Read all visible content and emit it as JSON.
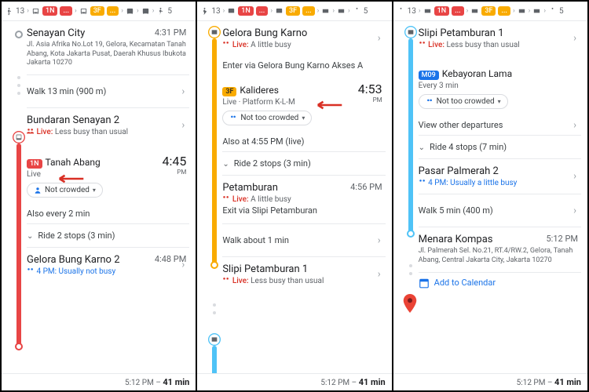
{
  "header": {
    "walk1": "13",
    "route1": "1N",
    "ellipsis": "...",
    "route2": "3F",
    "walk2": "5"
  },
  "p1": {
    "start": {
      "name": "Senayan City",
      "addr": "Jl. Asia Afrika No.Lot 19, Gelora, Kecamatan Tanah Abang, Kota Jakarta Pusat, Daerah Khusus Ibukota Jakarta 10270",
      "time": "4:31 PM"
    },
    "walk1": "Walk 13 min (900 m)",
    "stop1": {
      "name": "Bundaran Senayan 2",
      "live": "Less busy than usual"
    },
    "route": {
      "badge": "1N",
      "dest": "Tanah Abang",
      "live": "Live",
      "time": "4:45",
      "pm": "PM",
      "crowd": "Not crowded"
    },
    "also": "Also every 2 min",
    "ride": "Ride 2 stops (3 min)",
    "stop2": {
      "name": "Gelora Bung Karno 2",
      "hist": "4 PM: Usually not busy",
      "time": "4:48 PM"
    }
  },
  "p2": {
    "stop1": {
      "name": "Gelora Bung Karno",
      "live": "A little busy"
    },
    "enter": "Enter via Gelora Bung Karno Akses A",
    "route": {
      "badge": "3F",
      "dest": "Kalideres",
      "live": "Live · Platform K-L-M",
      "time": "4:53",
      "pm": "PM",
      "crowd": "Not too crowded"
    },
    "also": "Also at 4:55 PM (live)",
    "ride": "Ride 2 stops (3 min)",
    "stop2": {
      "name": "Petamburan",
      "live": "A little busy",
      "exit": "Exit via Slipi Petamburan",
      "time": "4:56 PM"
    },
    "walk": "Walk about 1 min",
    "stop3": {
      "name": "Slipi Petamburan 1",
      "live": "Less busy than usual"
    }
  },
  "p3": {
    "stop1": {
      "name": "Slipi Petamburan 1",
      "live": "Less busy than usual"
    },
    "route": {
      "badge": "M09",
      "dest": "Kebayoran Lama",
      "freq": "Every 3 min",
      "crowd": "Not too crowded"
    },
    "view": "View other departures",
    "ride": "Ride 4 stops (7 min)",
    "stop2": {
      "name": "Pasar Palmerah 2",
      "hist": "4 PM: Usually a little busy"
    },
    "walk": "Walk 5 min (400 m)",
    "dest": {
      "name": "Menara Kompas",
      "addr": "Jl. Palmerah Sel. No.21, RT.4/RW.2, Gelora, Tanah Abang, Central Jakarta City, Jakarta 10270",
      "time": "5:12 PM"
    },
    "cal": "Add to Calendar"
  },
  "footer": {
    "time": "5:12 PM",
    "dur": "41 min",
    "sep": "–"
  }
}
